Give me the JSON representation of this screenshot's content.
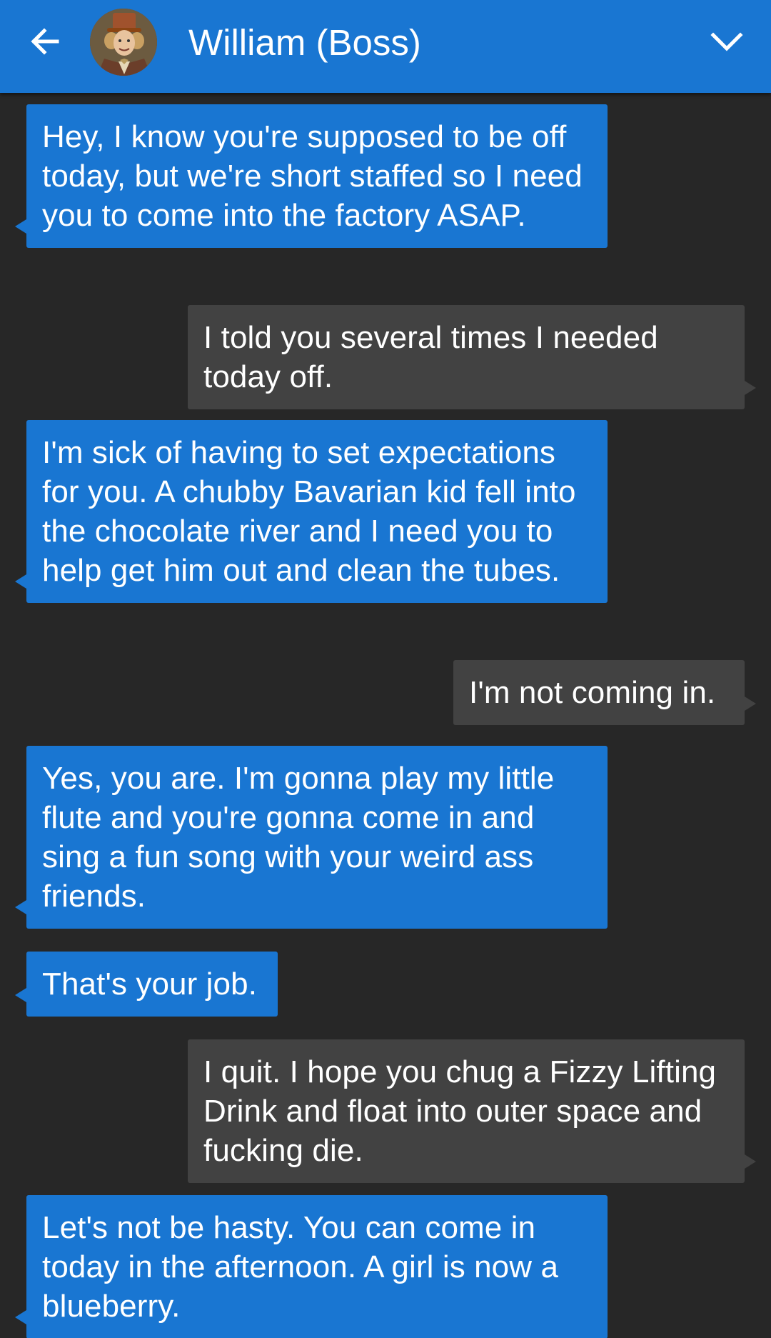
{
  "header": {
    "title": "William (Boss)",
    "back_icon": "arrow-left-icon",
    "menu_icon": "chevron-down-icon",
    "accent": "#1976d2"
  },
  "colors": {
    "background": "#272727",
    "incoming_bubble": "#1976d2",
    "outgoing_bubble": "#424242"
  },
  "messages": [
    {
      "direction": "incoming",
      "text": "Hey, I know you're supposed to be off today, but we're short staffed so I need you to come into the factory ASAP."
    },
    {
      "direction": "outgoing",
      "text": "I told you several times I needed today off."
    },
    {
      "direction": "incoming",
      "text": "I'm sick of having to set expectations for you. A chubby Bavarian kid fell into the chocolate river and I need you to help get him out and clean the tubes."
    },
    {
      "direction": "outgoing",
      "text": "I'm not coming in."
    },
    {
      "direction": "incoming",
      "text": "Yes, you are. I'm gonna play my little flute and you're gonna come in and sing a fun song with your weird ass friends."
    },
    {
      "direction": "incoming",
      "text": "That's your job."
    },
    {
      "direction": "outgoing",
      "text": "I quit. I hope you chug a Fizzy Lifting Drink and float into outer space and fucking die."
    },
    {
      "direction": "incoming",
      "text": "Let's not be hasty. You can come in today in the afternoon. A girl is now a blueberry."
    }
  ]
}
